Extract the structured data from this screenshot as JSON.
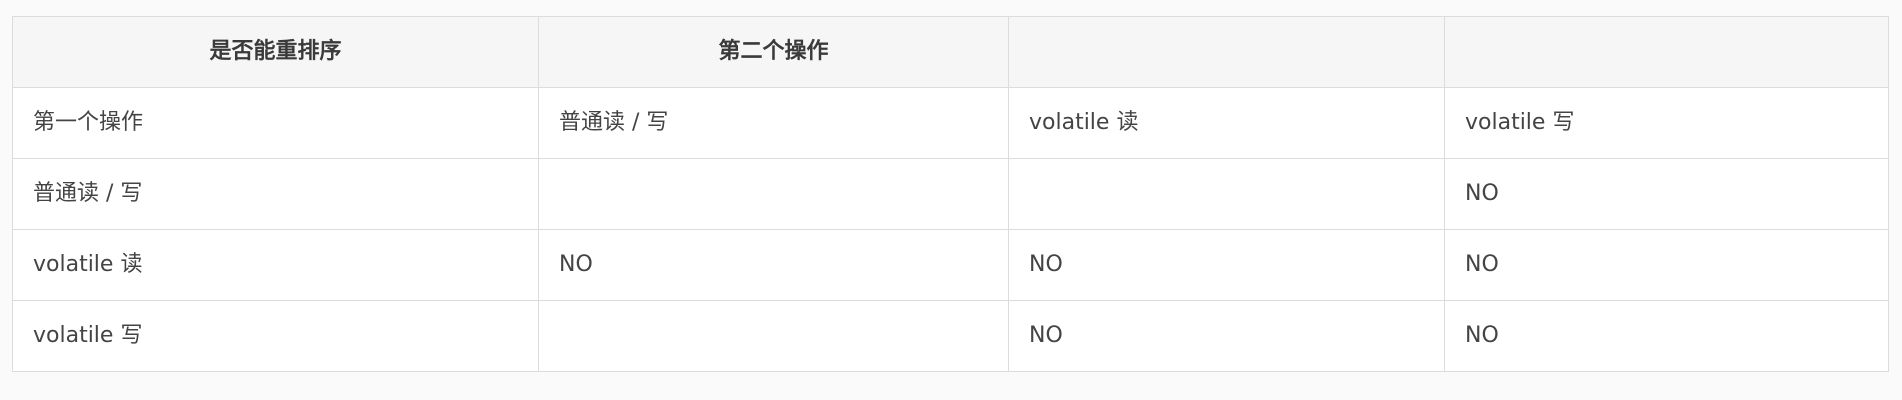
{
  "table": {
    "headers": [
      "是否能重排序",
      "第二个操作",
      "",
      ""
    ],
    "rows": [
      [
        "第一个操作",
        "普通读 / 写",
        "volatile 读",
        "volatile 写"
      ],
      [
        "普通读 / 写",
        "",
        "",
        "NO"
      ],
      [
        "volatile 读",
        "NO",
        "NO",
        "NO"
      ],
      [
        "volatile 写",
        "",
        "NO",
        "NO"
      ]
    ]
  }
}
